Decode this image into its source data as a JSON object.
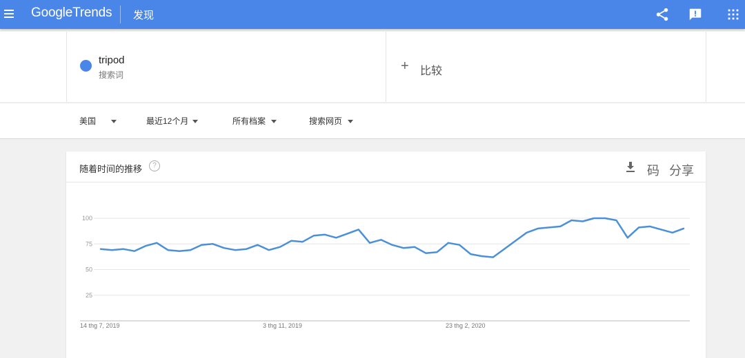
{
  "topbar": {
    "logo_google": "Google",
    "logo_trends": "Trends",
    "nav_label": "发现"
  },
  "term": {
    "name": "tripod",
    "type": "搜索词",
    "color": "#4a86e8"
  },
  "compare": {
    "plus": "+",
    "label": "比较"
  },
  "filters": {
    "region": "美国",
    "time": "最近12个月",
    "category": "所有档案",
    "property": "搜索网页"
  },
  "card": {
    "title": "随着时间的推移",
    "help": "?",
    "code_label": "码",
    "share_label": "分享"
  },
  "chart_data": {
    "type": "line",
    "x_labels": [
      "14 thg 7, 2019",
      "3 thg 11, 2019",
      "23 thg 2, 2020"
    ],
    "y_ticks": [
      25,
      50,
      75,
      100
    ],
    "ylim": [
      0,
      100
    ],
    "grid": true,
    "series": [
      {
        "color": "#4a90d9",
        "values": [
          70,
          69,
          70,
          68,
          73,
          76,
          69,
          68,
          69,
          74,
          75,
          71,
          69,
          70,
          74,
          69,
          72,
          78,
          77,
          83,
          84,
          81,
          85,
          89,
          76,
          79,
          74,
          71,
          72,
          66,
          67,
          76,
          74,
          65,
          63,
          62,
          70,
          78,
          86,
          90,
          91,
          92,
          98,
          97,
          100,
          100,
          98,
          81,
          91,
          92,
          89,
          86,
          90
        ]
      }
    ]
  }
}
